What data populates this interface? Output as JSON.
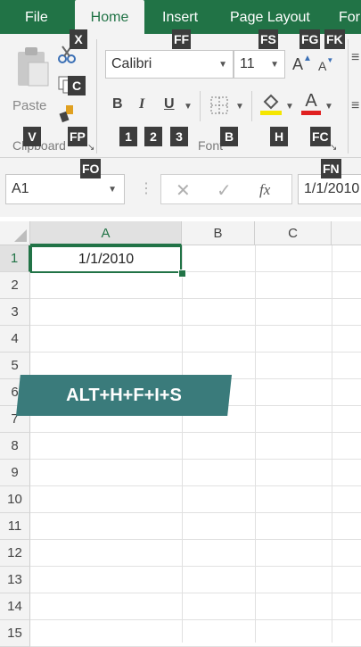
{
  "tabs": [
    "File",
    "Home",
    "Insert",
    "Page Layout",
    "For"
  ],
  "ribbon": {
    "paste_label": "Paste",
    "clipboard_label": "Clipboard",
    "font_group_label": "Font",
    "font_name": "Calibri",
    "font_size": "11",
    "bold": "B",
    "italic": "I",
    "underline": "U",
    "fill_color": "#f5e600",
    "font_color": "#e02020"
  },
  "keytips": {
    "x": "X",
    "c": "C",
    "fp": "FP",
    "v": "V",
    "fo": "FO",
    "ff": "FF",
    "fs": "FS",
    "fg": "FG",
    "fk": "FK",
    "k1": "1",
    "k2": "2",
    "k3": "3",
    "b": "B",
    "h": "H",
    "fc": "FC",
    "fn": "FN"
  },
  "formula_bar": {
    "name_box": "A1",
    "formula_value": "1/1/2010",
    "fx_label": "fx"
  },
  "sheet": {
    "columns": [
      "A",
      "B",
      "C"
    ],
    "rows": [
      "1",
      "2",
      "3",
      "4",
      "5",
      "6",
      "7",
      "8",
      "9",
      "10",
      "11",
      "12",
      "13",
      "14",
      "15"
    ],
    "active_cell_value": "1/1/2010"
  },
  "overlay": {
    "shortcut": "ALT+H+F+I+S"
  },
  "colors": {
    "excel_green": "#217346",
    "banner_teal": "#3a7b7b"
  }
}
